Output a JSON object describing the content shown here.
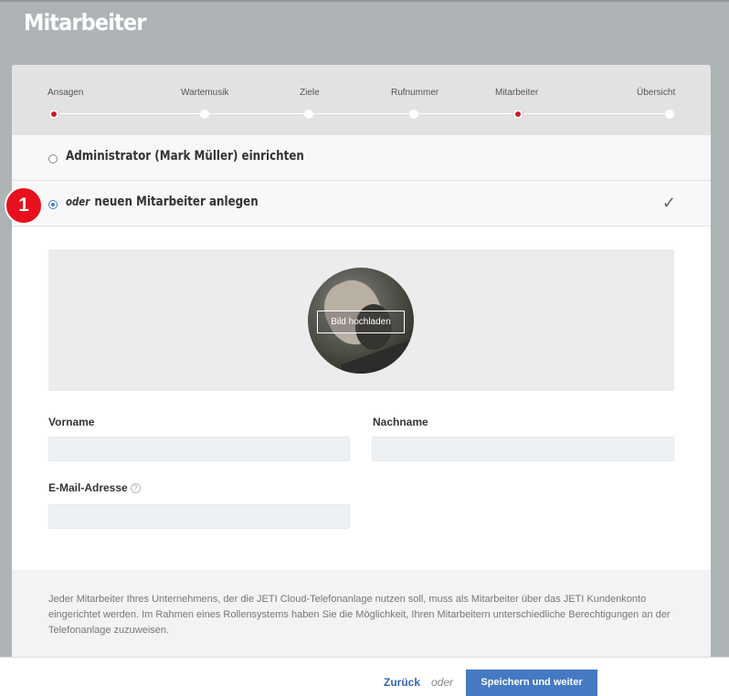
{
  "page": {
    "title": "Mitarbeiter"
  },
  "stepper": {
    "steps": [
      {
        "label": "Ansagen",
        "active": true
      },
      {
        "label": "Wartemusik",
        "active": false
      },
      {
        "label": "Ziele",
        "active": false
      },
      {
        "label": "Rufnummer",
        "active": false
      },
      {
        "label": "Mitarbeiter",
        "active": true
      },
      {
        "label": "Übersicht",
        "active": false
      }
    ]
  },
  "options": {
    "admin": {
      "label": "Administrator (Mark Müller) einrichten",
      "selected": false
    },
    "new_employee": {
      "prefix": "oder",
      "label": "neuen Mitarbeiter anlegen",
      "selected": true,
      "check": "✓"
    }
  },
  "annotation": {
    "badge": "1"
  },
  "upload": {
    "button_label": "Bild hochladen"
  },
  "form": {
    "first_name": {
      "label": "Vorname",
      "value": "",
      "placeholder": ""
    },
    "last_name": {
      "label": "Nachname",
      "value": "",
      "placeholder": ""
    },
    "email": {
      "label": "E-Mail-Adresse",
      "value": "",
      "placeholder": "",
      "help": "?"
    }
  },
  "info": {
    "text": "Jeder Mitarbeiter Ihres Unternehmens, der die JETI Cloud-Telefonanlage nutzen soll, muss als Mitarbeiter über das JETI Kundenkonto eingerichtet werden. Im Rahmen eines Rollensystems haben Sie die Möglichkeit, Ihren Mitarbeitern unterschiedliche Berechtigungen an der Telefonanlage zuzuweisen."
  },
  "footer": {
    "back_label": "Zurück",
    "or_label": "oder",
    "save_label": "Speichern und weiter"
  },
  "colors": {
    "accent": "#4679c4",
    "active_step": "#c81e2b",
    "badge": "#e8101e",
    "radio_selected": "#3f7fd0"
  }
}
